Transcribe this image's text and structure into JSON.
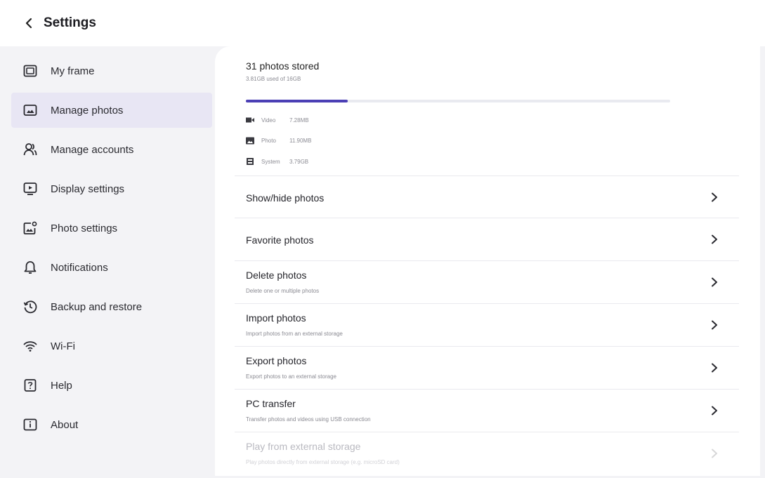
{
  "header": {
    "title": "Settings",
    "back_icon": "chevron-left-icon"
  },
  "sidebar": {
    "active_color": "#e8e6f4",
    "items": [
      {
        "label": "My frame",
        "icon": "frame-icon"
      },
      {
        "label": "Manage photos",
        "icon": "photo-gallery-icon",
        "active": true
      },
      {
        "label": "Manage accounts",
        "icon": "accounts-icon"
      },
      {
        "label": "Display settings",
        "icon": "display-icon"
      },
      {
        "label": "Photo settings",
        "icon": "photo-settings-icon"
      },
      {
        "label": "Notifications",
        "icon": "bell-icon"
      },
      {
        "label": "Backup and restore",
        "icon": "backup-icon"
      },
      {
        "label": "Wi-Fi",
        "icon": "wifi-icon"
      },
      {
        "label": "Help",
        "icon": "help-icon"
      },
      {
        "label": "About",
        "icon": "info-icon"
      }
    ]
  },
  "storage": {
    "title": "31 photos stored",
    "subtitle": "3.81GB used of 16GB",
    "used_fraction": 0.24,
    "bar_color": "#4b3fb5",
    "legend": [
      {
        "name": "Video",
        "size": "7.28MB",
        "icon": "video-icon"
      },
      {
        "name": "Photo",
        "size": "11.90MB",
        "icon": "photo-icon"
      },
      {
        "name": "System",
        "size": "3.79GB",
        "icon": "system-icon"
      }
    ]
  },
  "rows": [
    {
      "title": "Show/hide photos",
      "desc": ""
    },
    {
      "title": "Favorite photos",
      "desc": ""
    },
    {
      "title": "Delete photos",
      "desc": "Delete one or multiple photos"
    },
    {
      "title": "Import photos",
      "desc": "Import photos from an external storage"
    },
    {
      "title": "Export photos",
      "desc": "Export photos to an external storage"
    },
    {
      "title": "PC transfer",
      "desc": "Transfer photos and videos using USB connection"
    },
    {
      "title": "Play from external storage",
      "desc": "Play photos directly from external storage (e.g. microSD card)",
      "disabled": true
    }
  ]
}
